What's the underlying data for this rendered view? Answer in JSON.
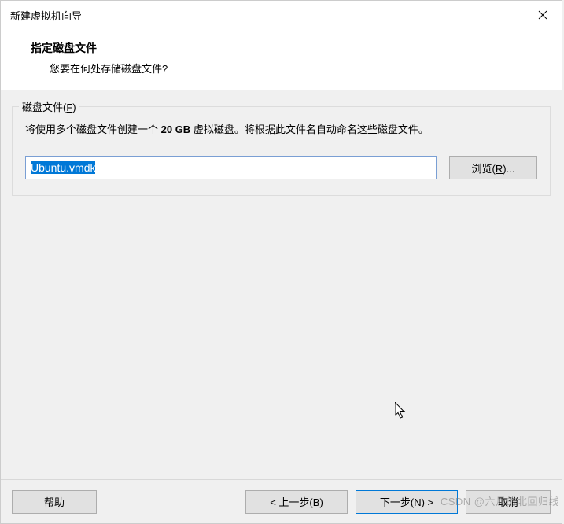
{
  "titlebar": {
    "title": "新建虚拟机向导"
  },
  "header": {
    "title": "指定磁盘文件",
    "subtitle": "您要在何处存储磁盘文件?"
  },
  "group": {
    "label_prefix": "磁盘文件(",
    "label_key": "F",
    "label_suffix": ")",
    "description_pre": "将使用多个磁盘文件创建一个 ",
    "description_bold": "20 GB",
    "description_post": " 虚拟磁盘。将根据此文件名自动命名这些磁盘文件。"
  },
  "file": {
    "value": "Ubuntu.vmdk",
    "browse_prefix": "浏览(",
    "browse_key": "R",
    "browse_suffix": ")..."
  },
  "buttons": {
    "help": "帮助",
    "back_prefix": "< 上一步(",
    "back_key": "B",
    "back_suffix": ")",
    "next_prefix": "下一步(",
    "next_key": "N",
    "next_suffix": ") >",
    "cancel": "取消"
  },
  "watermark": "CSDN @六月的北回归线"
}
